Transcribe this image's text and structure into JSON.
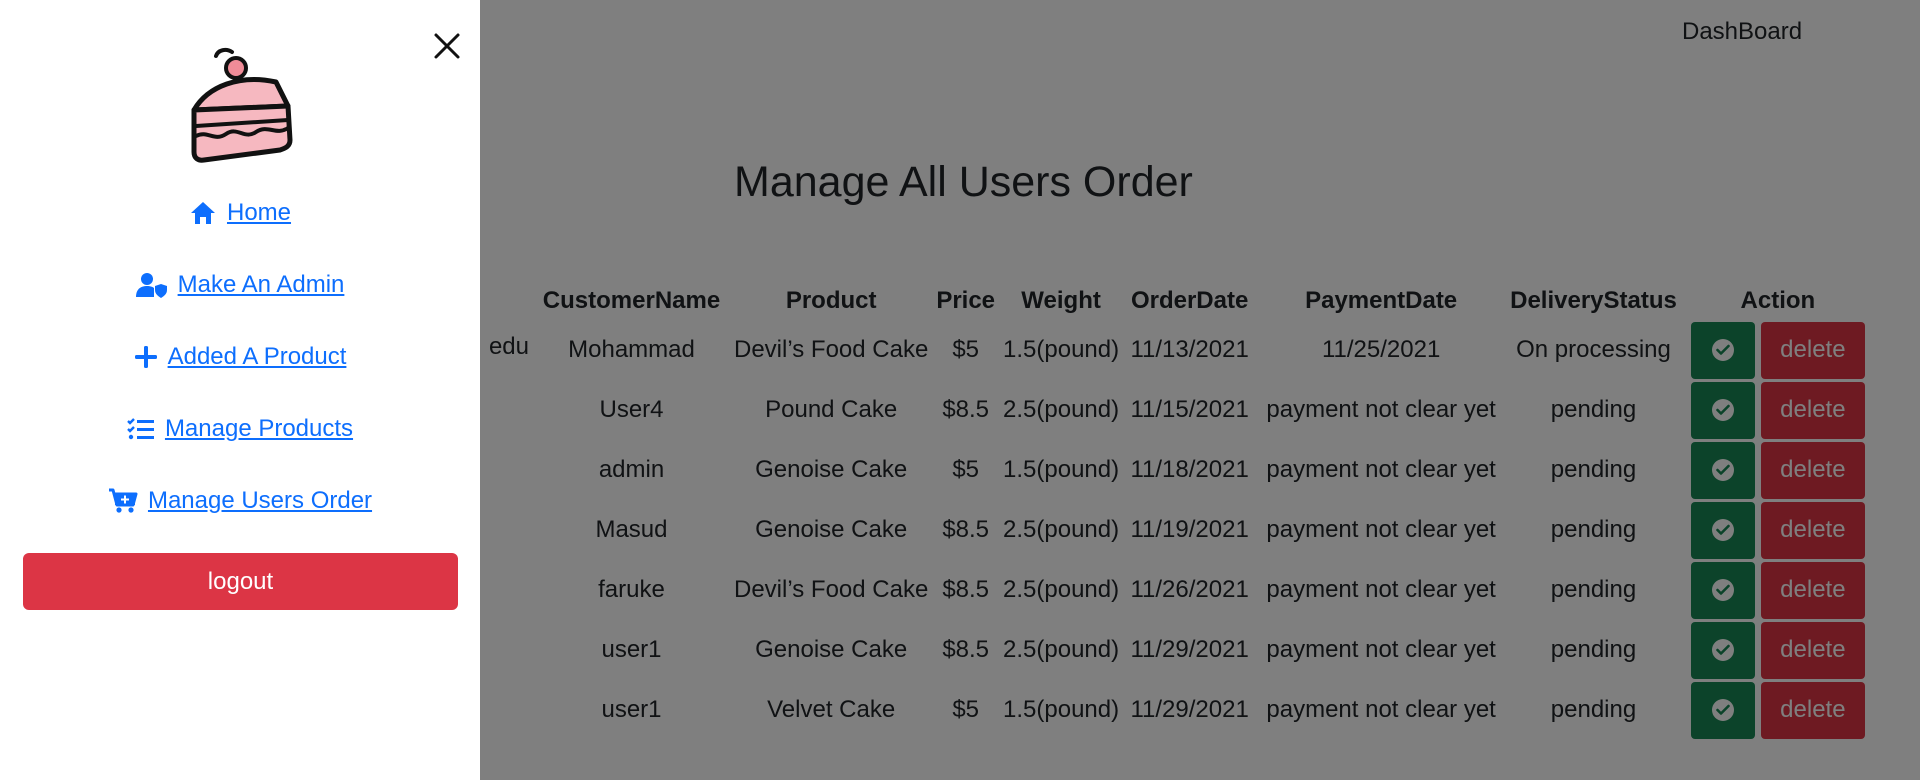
{
  "header": {
    "dashboard_link": "DashBoard"
  },
  "main": {
    "title": "Manage All Users Order",
    "columns": [
      "CustomerName",
      "Product",
      "Price",
      "Weight",
      "OrderDate",
      "PaymentDate",
      "DeliveryStatus",
      "Action"
    ],
    "rows": [
      {
        "email": "edu",
        "name": "Mohammad",
        "product": "Devil’s Food Cake",
        "price": "$5",
        "weight": "1.5(pound)",
        "order_date": "11/13/2021",
        "payment_date": "11/25/2021",
        "status": "On processing",
        "delete_label": "delete"
      },
      {
        "email": "",
        "name": "User4",
        "product": "Pound Cake",
        "price": "$8.5",
        "weight": "2.5(pound)",
        "order_date": "11/15/2021",
        "payment_date": "payment not clear yet",
        "status": "pending",
        "delete_label": "delete"
      },
      {
        "email": "",
        "name": "admin",
        "product": "Genoise Cake",
        "price": "$5",
        "weight": "1.5(pound)",
        "order_date": "11/18/2021",
        "payment_date": "payment not clear yet",
        "status": "pending",
        "delete_label": "delete"
      },
      {
        "email": "",
        "name": "Masud",
        "product": "Genoise Cake",
        "price": "$8.5",
        "weight": "2.5(pound)",
        "order_date": "11/19/2021",
        "payment_date": "payment not clear yet",
        "status": "pending",
        "delete_label": "delete"
      },
      {
        "email": "",
        "name": "faruke",
        "product": "Devil’s Food Cake",
        "price": "$8.5",
        "weight": "2.5(pound)",
        "order_date": "11/26/2021",
        "payment_date": "payment not clear yet",
        "status": "pending",
        "delete_label": "delete"
      },
      {
        "email": "",
        "name": "user1",
        "product": "Genoise Cake",
        "price": "$8.5",
        "weight": "2.5(pound)",
        "order_date": "11/29/2021",
        "payment_date": "payment not clear yet",
        "status": "pending",
        "delete_label": "delete"
      },
      {
        "email": "",
        "name": "user1",
        "product": "Velvet Cake",
        "price": "$5",
        "weight": "1.5(pound)",
        "order_date": "11/29/2021",
        "payment_date": "payment not clear yet",
        "status": "pending",
        "delete_label": "delete"
      }
    ]
  },
  "drawer": {
    "logo": "cake-slice-logo",
    "close_icon": "close-icon",
    "nav": [
      {
        "label": "Home",
        "icon": "home-icon"
      },
      {
        "label": "Make An Admin",
        "icon": "user-shield-icon"
      },
      {
        "label": "Added A Product",
        "icon": "plus-icon"
      },
      {
        "label": "Manage Products",
        "icon": "checklist-icon"
      },
      {
        "label": "Manage Users Order",
        "icon": "cart-plus-icon"
      }
    ],
    "logout_label": "logout"
  },
  "colors": {
    "primary": "#0d6efd",
    "danger": "#dc3545",
    "success": "#198754",
    "backdrop": "rgba(0,0,0,0.5)"
  }
}
